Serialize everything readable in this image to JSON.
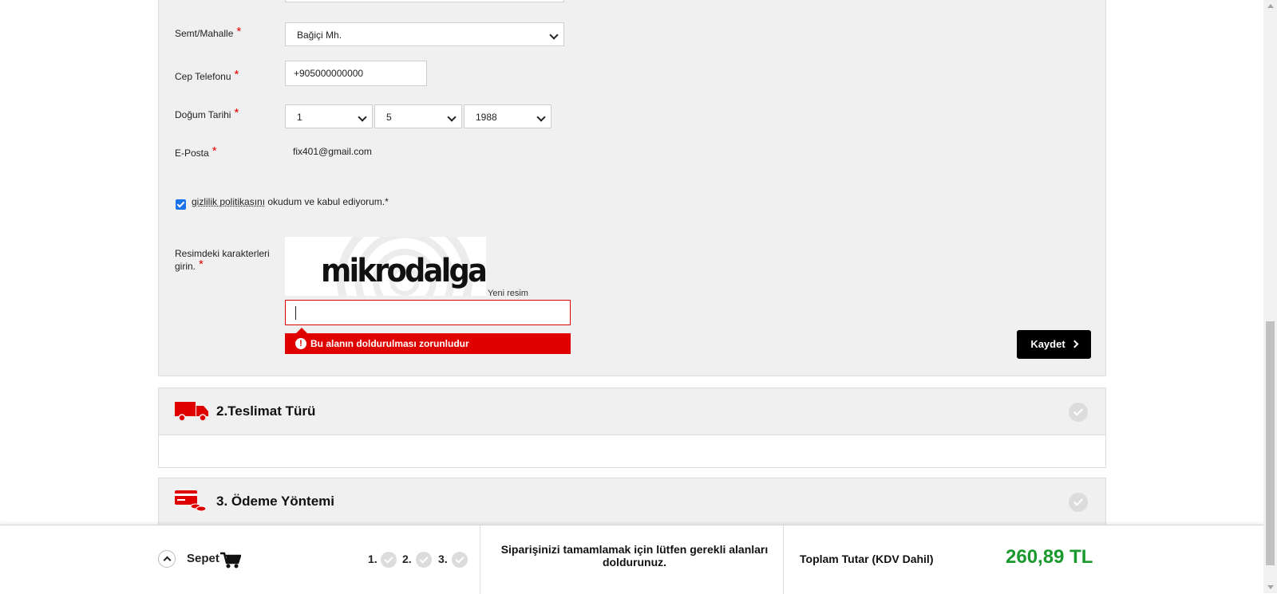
{
  "form": {
    "district": {
      "label": "Semt/Mahalle",
      "required_mark": "*",
      "value": "Bağiçi Mh."
    },
    "mobile": {
      "label": "Cep Telefonu",
      "required_mark": "*",
      "value": "+905000000000"
    },
    "birth_date": {
      "label": "Doğum Tarihi",
      "required_mark": "*",
      "day": "1",
      "month": "5",
      "year": "1988"
    },
    "email": {
      "label": "E-Posta",
      "required_mark": "*",
      "value": "fix401@gmail.com"
    },
    "consent": {
      "link_text": "gizlilik politikasını",
      "rest_text": " okudum ve kabul ediyorum.*",
      "checked": true
    },
    "captcha": {
      "label_line1": "Resimdeki karakterleri",
      "label_line2": "girin.",
      "required_mark": "*",
      "image_text": "mikrodalga",
      "new_image": "Yeni resim",
      "value": "",
      "error": "Bu alanın doldurulması zorunludur",
      "error_icon": "!"
    },
    "save_label": "Kaydet"
  },
  "sections": [
    {
      "title": "2.Teslimat Türü",
      "icon": "truck-icon"
    },
    {
      "title": "3. Ödeme Yöntemi",
      "icon": "payment-icon"
    }
  ],
  "bottom_bar": {
    "basket_label": "Sepet",
    "steps": [
      "1.",
      "2.",
      "3."
    ],
    "message": "Siparişinizi tamamlamak için lütfen gerekli alanları doldurunuz.",
    "total_label": "Toplam Tutar (KDV Dahil)",
    "total_value": "260,89 TL"
  },
  "colors": {
    "accent_red": "#df0000",
    "total_green": "#1a9a2e",
    "button_black": "#000000"
  }
}
